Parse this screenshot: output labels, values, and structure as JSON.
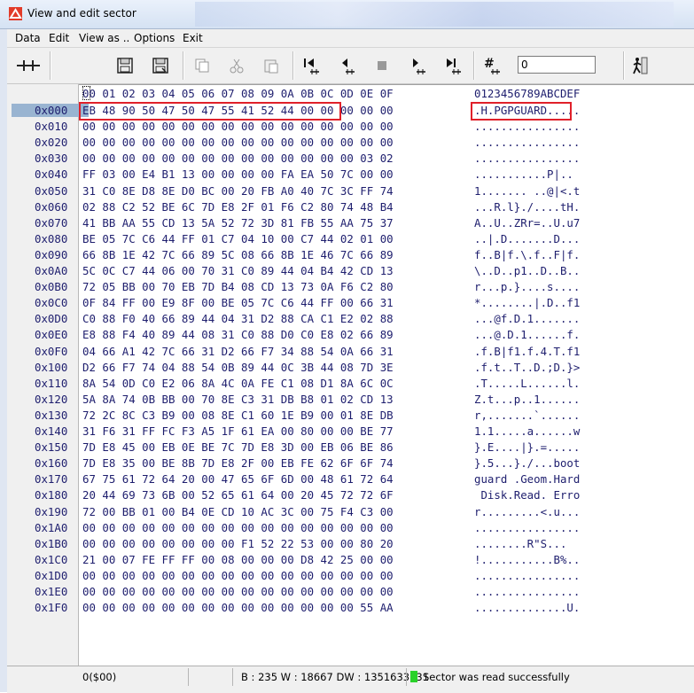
{
  "window": {
    "title": "View and edit sector"
  },
  "menu": {
    "items": [
      "Data",
      "Edit",
      "View as ..",
      "Options",
      "Exit"
    ]
  },
  "toolbar": {
    "sector_value": "0"
  },
  "hex": {
    "header_hex": "00 01 02 03 04 05 06 07 08 09 0A 0B 0C 0D 0E 0F",
    "header_ascii": "0123456789ABCDEF",
    "rows": [
      {
        "addr": "0x000",
        "hex": "EB 48 90 50 47 50 47 55 41 52 44 00 00 00 00 00",
        "ascii": ".H.PGPGUARD....."
      },
      {
        "addr": "0x010",
        "hex": "00 00 00 00 00 00 00 00 00 00 00 00 00 00 00 00",
        "ascii": "................"
      },
      {
        "addr": "0x020",
        "hex": "00 00 00 00 00 00 00 00 00 00 00 00 00 00 00 00",
        "ascii": "................"
      },
      {
        "addr": "0x030",
        "hex": "00 00 00 00 00 00 00 00 00 00 00 00 00 00 03 02",
        "ascii": "................"
      },
      {
        "addr": "0x040",
        "hex": "FF 03 00 E4 B1 13 00 00 00 00 FA EA 50 7C 00 00",
        "ascii": "...........P|.."
      },
      {
        "addr": "0x050",
        "hex": "31 C0 8E D8 8E D0 BC 00 20 FB A0 40 7C 3C FF 74",
        "ascii": "1....... ..@|<.t"
      },
      {
        "addr": "0x060",
        "hex": "02 88 C2 52 BE 6C 7D E8 2F 01 F6 C2 80 74 48 B4",
        "ascii": "...R.l}./....tH."
      },
      {
        "addr": "0x070",
        "hex": "41 BB AA 55 CD 13 5A 52 72 3D 81 FB 55 AA 75 37",
        "ascii": "A..U..ZRr=..U.u7"
      },
      {
        "addr": "0x080",
        "hex": "BE 05 7C C6 44 FF 01 C7 04 10 00 C7 44 02 01 00",
        "ascii": "..|.D.......D..."
      },
      {
        "addr": "0x090",
        "hex": "66 8B 1E 42 7C 66 89 5C 08 66 8B 1E 46 7C 66 89",
        "ascii": "f..B|f.\\.f..F|f."
      },
      {
        "addr": "0x0A0",
        "hex": "5C 0C C7 44 06 00 70 31 C0 89 44 04 B4 42 CD 13",
        "ascii": "\\..D..p1..D..B.."
      },
      {
        "addr": "0x0B0",
        "hex": "72 05 BB 00 70 EB 7D B4 08 CD 13 73 0A F6 C2 80",
        "ascii": "r...p.}....s...."
      },
      {
        "addr": "0x0C0",
        "hex": "0F 84 FF 00 E9 8F 00 BE 05 7C C6 44 FF 00 66 31",
        "ascii": "*........|.D..f1"
      },
      {
        "addr": "0x0D0",
        "hex": "C0 88 F0 40 66 89 44 04 31 D2 88 CA C1 E2 02 88",
        "ascii": "...@f.D.1......."
      },
      {
        "addr": "0x0E0",
        "hex": "E8 88 F4 40 89 44 08 31 C0 88 D0 C0 E8 02 66 89",
        "ascii": "...@.D.1......f."
      },
      {
        "addr": "0x0F0",
        "hex": "04 66 A1 42 7C 66 31 D2 66 F7 34 88 54 0A 66 31",
        "ascii": ".f.B|f1.f.4.T.f1"
      },
      {
        "addr": "0x100",
        "hex": "D2 66 F7 74 04 88 54 0B 89 44 0C 3B 44 08 7D 3E",
        "ascii": ".f.t..T..D.;D.}>"
      },
      {
        "addr": "0x110",
        "hex": "8A 54 0D C0 E2 06 8A 4C 0A FE C1 08 D1 8A 6C 0C",
        "ascii": ".T.....L......l."
      },
      {
        "addr": "0x120",
        "hex": "5A 8A 74 0B BB 00 70 8E C3 31 DB B8 01 02 CD 13",
        "ascii": "Z.t...p..1......"
      },
      {
        "addr": "0x130",
        "hex": "72 2C 8C C3 B9 00 08 8E C1 60 1E B9 00 01 8E DB",
        "ascii": "r,.......`......"
      },
      {
        "addr": "0x140",
        "hex": "31 F6 31 FF FC F3 A5 1F 61 EA 00 80 00 00 BE 77",
        "ascii": "1.1.....a......w"
      },
      {
        "addr": "0x150",
        "hex": "7D E8 45 00 EB 0E BE 7C 7D E8 3D 00 EB 06 BE 86",
        "ascii": "}.E....|}.=....."
      },
      {
        "addr": "0x160",
        "hex": "7D E8 35 00 BE 8B 7D E8 2F 00 EB FE 62 6F 6F 74",
        "ascii": "}.5...}./...boot"
      },
      {
        "addr": "0x170",
        "hex": "67 75 61 72 64 20 00 47 65 6F 6D 00 48 61 72 64",
        "ascii": "guard .Geom.Hard"
      },
      {
        "addr": "0x180",
        "hex": "20 44 69 73 6B 00 52 65 61 64 00 20 45 72 72 6F",
        "ascii": " Disk.Read. Erro"
      },
      {
        "addr": "0x190",
        "hex": "72 00 BB 01 00 B4 0E CD 10 AC 3C 00 75 F4 C3 00",
        "ascii": "r.........<.u..."
      },
      {
        "addr": "0x1A0",
        "hex": "00 00 00 00 00 00 00 00 00 00 00 00 00 00 00 00",
        "ascii": "................"
      },
      {
        "addr": "0x1B0",
        "hex": "00 00 00 00 00 00 00 00 F1 52 22 53 00 00 80 20",
        "ascii": "........R\"S...  "
      },
      {
        "addr": "0x1C0",
        "hex": "21 00 07 FE FF FF 00 08 00 00 00 D8 42 25 00 00",
        "ascii": "!...........B%.."
      },
      {
        "addr": "0x1D0",
        "hex": "00 00 00 00 00 00 00 00 00 00 00 00 00 00 00 00",
        "ascii": "................"
      },
      {
        "addr": "0x1E0",
        "hex": "00 00 00 00 00 00 00 00 00 00 00 00 00 00 00 00",
        "ascii": "................"
      },
      {
        "addr": "0x1F0",
        "hex": "00 00 00 00 00 00 00 00 00 00 00 00 00 00 55 AA",
        "ascii": "..............U."
      }
    ]
  },
  "status": {
    "offset": "0($00)",
    "values": "B : 235 W : 18667 DW : 1351633131",
    "message": "Sector was read successfully",
    "ok_color": "#2ad12a",
    "highlight_color": "#e0202a"
  }
}
